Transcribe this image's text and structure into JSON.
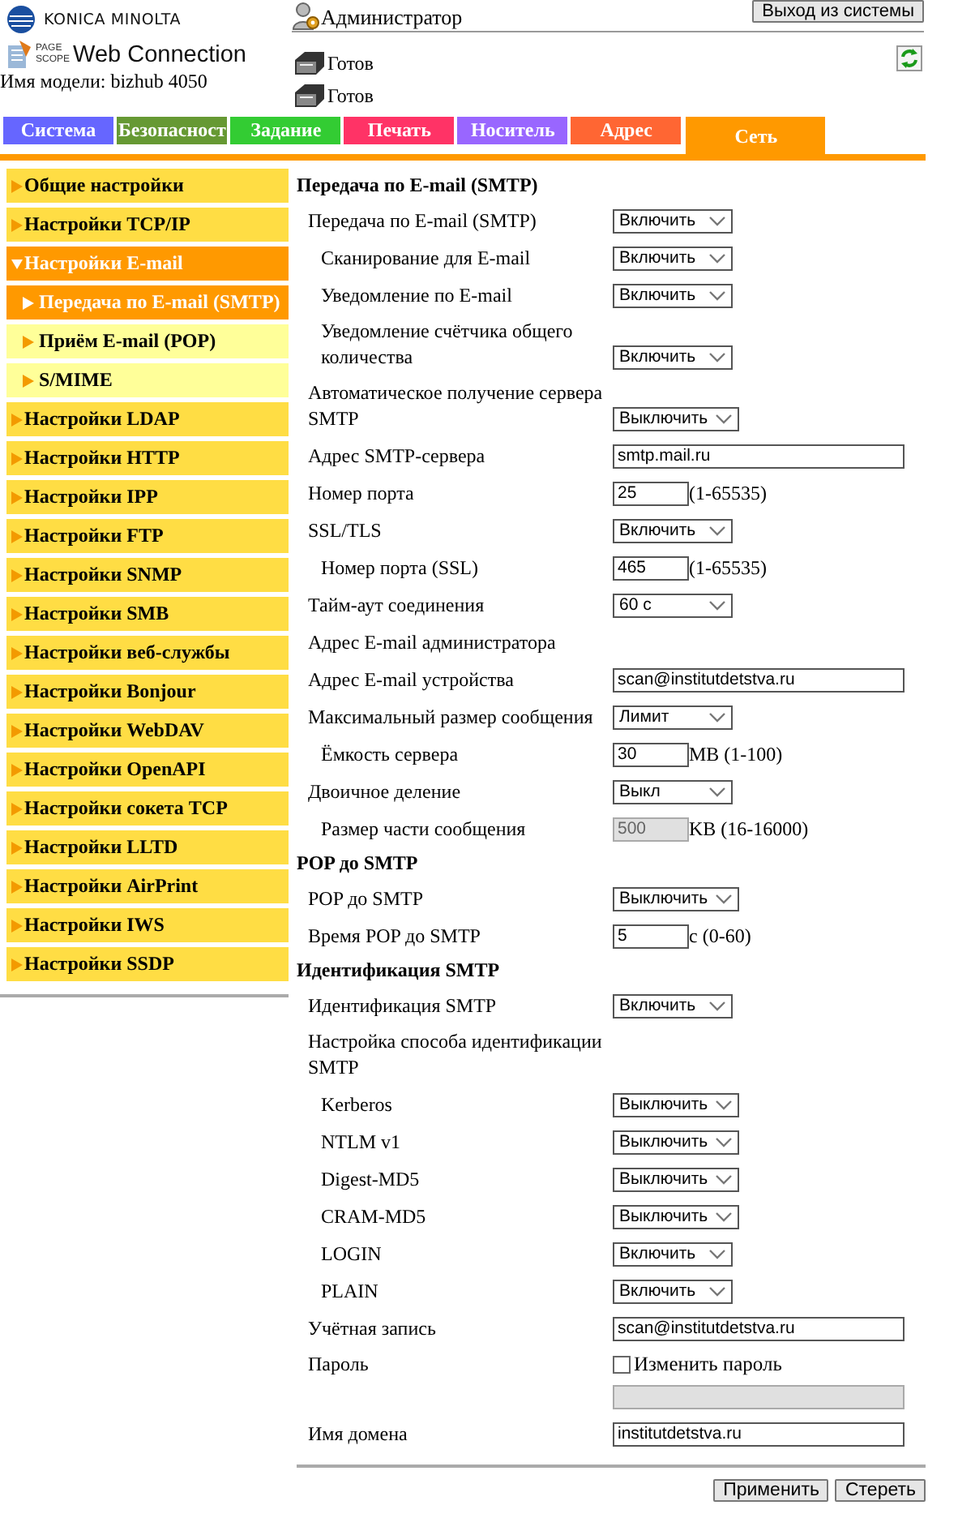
{
  "brand": {
    "company": "KONICA MINOLTA",
    "product_top": "PAGE",
    "product_bottom": "SCOPE",
    "product": "Web Connection",
    "model": "Имя модели: bizhub 4050"
  },
  "user": {
    "name": "Администратор",
    "logout": "Выход из системы"
  },
  "status": [
    "Готов",
    "Готов"
  ],
  "tabs": [
    {
      "label": "Система",
      "color": "#6666ff",
      "selected": false
    },
    {
      "label": "Безопасност",
      "color": "#669933",
      "selected": false
    },
    {
      "label": "Задание",
      "color": "#33cc33",
      "selected": false
    },
    {
      "label": "Печать",
      "color": "#ff3366",
      "selected": false
    },
    {
      "label": "Носитель",
      "color": "#9966ff",
      "selected": false
    },
    {
      "label": "Адрес",
      "color": "#ff6633",
      "selected": false
    },
    {
      "label": "Сеть",
      "color": "#ff9900",
      "selected": true
    }
  ],
  "sidebar": {
    "items": [
      {
        "label": "Общие настройки",
        "expanded": false
      },
      {
        "label": "Настройки TCP/IP",
        "expanded": false
      },
      {
        "label": "Настройки E-mail",
        "expanded": true,
        "children": [
          {
            "label": "Передача по E-mail (SMTP)",
            "selected": true
          },
          {
            "label": "Приём E-mail (POP)",
            "selected": false
          },
          {
            "label": "S/MIME",
            "selected": false
          }
        ]
      },
      {
        "label": "Настройки LDAP",
        "expanded": false
      },
      {
        "label": "Настройки HTTP",
        "expanded": false
      },
      {
        "label": "Настройки IPP",
        "expanded": false
      },
      {
        "label": "Настройки FTP",
        "expanded": false
      },
      {
        "label": "Настройки SNMP",
        "expanded": false
      },
      {
        "label": "Настройки SMB",
        "expanded": false
      },
      {
        "label": "Настройки веб-службы",
        "expanded": false
      },
      {
        "label": "Настройки Bonjour",
        "expanded": false
      },
      {
        "label": "Настройки WebDAV",
        "expanded": false
      },
      {
        "label": "Настройки OpenAPI",
        "expanded": false
      },
      {
        "label": "Настройки сокета TCP",
        "expanded": false
      },
      {
        "label": "Настройки LLTD",
        "expanded": false
      },
      {
        "label": "Настройки AirPrint",
        "expanded": false
      },
      {
        "label": "Настройки IWS",
        "expanded": false
      },
      {
        "label": "Настройки SSDP",
        "expanded": false
      }
    ]
  },
  "form": {
    "sections": [
      {
        "title": "Передача по E-mail (SMTP)",
        "rows": [
          {
            "kind": "select",
            "label": "Передача по E-mail (SMTP)",
            "value": "Включить",
            "children": [
              {
                "kind": "select",
                "label": "Сканирование для E-mail",
                "value": "Включить"
              },
              {
                "kind": "select",
                "label": "Уведомление по E-mail",
                "value": "Включить"
              },
              {
                "kind": "select",
                "label": "Уведомление счётчика общего количества",
                "value": "Включить"
              }
            ]
          },
          {
            "kind": "select",
            "label": "Автоматическое получение сервера SMTP",
            "value": "Выключить"
          },
          {
            "kind": "text",
            "label": "Адрес SMTP-сервера",
            "value": "smtp.mail.ru"
          },
          {
            "kind": "number",
            "label": "Номер порта",
            "value": "25",
            "hint": "(1-65535)",
            "disabled": false
          },
          {
            "kind": "select",
            "label": "SSL/TLS",
            "value": "Включить",
            "children": [
              {
                "kind": "number",
                "label": "Номер порта (SSL)",
                "value": "465",
                "hint": "(1-65535)",
                "disabled": false
              }
            ]
          },
          {
            "kind": "select",
            "label": "Тайм-аут соединения",
            "value": "60 с"
          },
          {
            "kind": "label",
            "label": "Адрес E-mail администратора"
          },
          {
            "kind": "text",
            "label": "Адрес E-mail устройства",
            "value": "scan@institutdetstva.ru"
          },
          {
            "kind": "select",
            "label": "Максимальный размер сообщения",
            "value": "Лимит",
            "children": [
              {
                "kind": "number",
                "label": "Ёмкость сервера",
                "value": "30",
                "hint": "MB (1-100)",
                "disabled": false
              }
            ]
          },
          {
            "kind": "select",
            "label": "Двоичное деление",
            "value": "Выкл",
            "children": [
              {
                "kind": "number",
                "label": "Размер части сообщения",
                "value": "500",
                "hint": "KB (16-16000)",
                "disabled": true
              }
            ]
          }
        ]
      },
      {
        "title": "POP до SMTP",
        "rows": [
          {
            "kind": "select",
            "label": "POP до SMTP",
            "value": "Выключить"
          },
          {
            "kind": "number",
            "label": "Время POP до SMTP",
            "value": "5",
            "hint": "с (0-60)",
            "disabled": false
          }
        ]
      },
      {
        "title": "Идентификация SMTP",
        "rows": [
          {
            "kind": "select",
            "label": "Идентификация SMTP",
            "value": "Включить"
          },
          {
            "kind": "label",
            "label": "Настройка способа идентификации SMTP",
            "children": [
              {
                "kind": "select",
                "label": "Kerberos",
                "value": "Выключить"
              },
              {
                "kind": "select",
                "label": "NTLM v1",
                "value": "Выключить"
              },
              {
                "kind": "select",
                "label": "Digest-MD5",
                "value": "Выключить"
              },
              {
                "kind": "select",
                "label": "CRAM-MD5",
                "value": "Выключить"
              },
              {
                "kind": "select",
                "label": "LOGIN",
                "value": "Включить"
              },
              {
                "kind": "select",
                "label": "PLAIN",
                "value": "Включить"
              }
            ]
          },
          {
            "kind": "text",
            "label": "Учётная запись",
            "value": "scan@institutdetstva.ru"
          },
          {
            "kind": "password",
            "label": "Пароль",
            "option": "Изменить пароль",
            "checked": false
          },
          {
            "kind": "text",
            "label": "Имя домена",
            "value": "institutdetstva.ru"
          }
        ]
      }
    ]
  },
  "buttons": [
    "Применить",
    "Стереть"
  ]
}
